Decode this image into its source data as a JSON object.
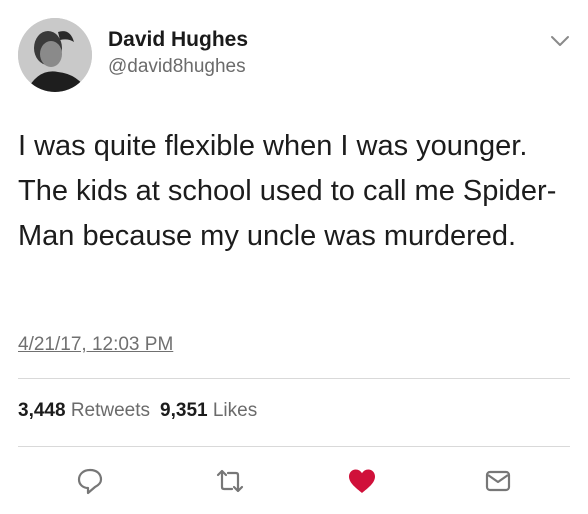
{
  "author": {
    "display_name": "David Hughes",
    "handle": "@david8hughes"
  },
  "tweet": {
    "text": "I was quite flexible when I was younger. The kids at school used to call me Spider-Man because my uncle was murdered.",
    "timestamp": "4/21/17, 12:03 PM"
  },
  "stats": {
    "retweets_count": "3,448",
    "retweets_label": "Retweets",
    "likes_count": "9,351",
    "likes_label": "Likes"
  },
  "actions": {
    "reply_icon": "reply-icon",
    "retweet_icon": "retweet-icon",
    "like_icon": "heart-icon",
    "dm_icon": "envelope-icon"
  },
  "colors": {
    "like_active": "#e0245e",
    "icon_gray": "#777777"
  }
}
